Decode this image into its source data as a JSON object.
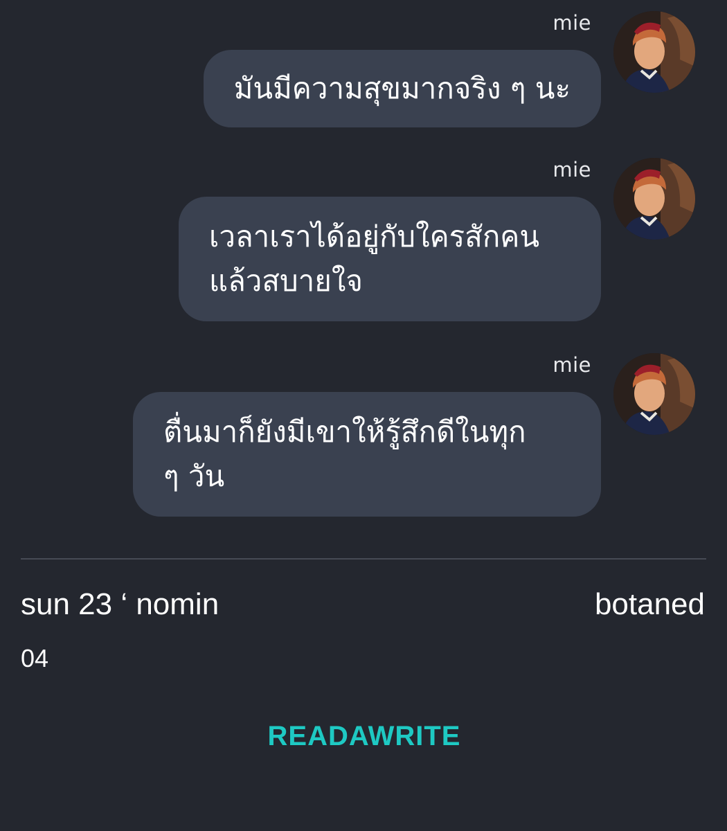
{
  "messages": [
    {
      "sender": "mie",
      "lines": [
        "มันมีความสุขมากจริง ๆ นะ"
      ]
    },
    {
      "sender": "mie",
      "lines": [
        "เวลาเราได้อยู่กับใครสักคน",
        "แล้วสบายใจ"
      ]
    },
    {
      "sender": "mie",
      "lines": [
        "ตื่นมาก็ยังมีเขาให้รู้สึกดีในทุก",
        "ๆ วัน"
      ]
    }
  ],
  "footer": {
    "title": "sun 23 ‘ nomin",
    "chapter": "04",
    "author": "botaned"
  },
  "brand": {
    "logo_text": "READAWRITE",
    "logo_color": "#1ec9c3"
  },
  "colors": {
    "background": "#24272f",
    "bubble": "#3a4150"
  },
  "icons": [
    "avatar-image"
  ]
}
